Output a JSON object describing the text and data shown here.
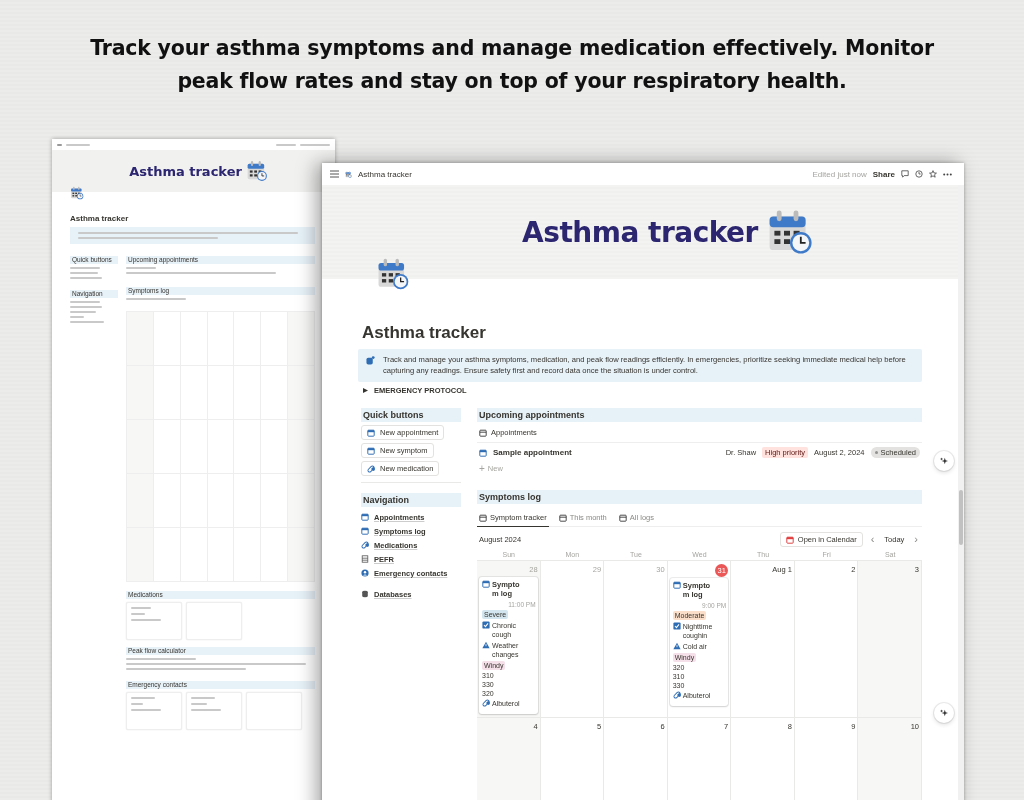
{
  "headline": [
    "Track your asthma symptoms and manage medication effectively. Monitor",
    "peak flow rates and stay on top of your respiratory health."
  ],
  "back_window": {
    "banner_title": "Asthma tracker",
    "title": "Asthma tracker",
    "side_sections": [
      "Quick buttons",
      "Navigation"
    ],
    "main_sections": [
      "Upcoming appointments",
      "Symptoms log",
      "Medications",
      "Peak flow calculator",
      "Emergency contacts"
    ]
  },
  "window": {
    "breadcrumb": "Asthma tracker",
    "edited": "Edited just now",
    "share": "Share"
  },
  "cover": {
    "title": "Asthma tracker"
  },
  "page": {
    "title": "Asthma tracker",
    "callout": "Track and manage your asthma symptoms, medication, and peak flow readings efficiently. In emergencies, prioritize seeking immediate medical help before capturing any readings. Ensure safety first and record data once the situation is under control.",
    "toggle": "EMERGENCY PROTOCOL"
  },
  "quick_buttons": {
    "heading": "Quick buttons",
    "buttons": [
      {
        "label": "New appointment",
        "kind": "calendar"
      },
      {
        "label": "New symptom",
        "kind": "calendar"
      },
      {
        "label": "New medication",
        "kind": "pill"
      }
    ]
  },
  "navigation": {
    "heading": "Navigation",
    "items": [
      {
        "label": "Appointments",
        "kind": "calendar"
      },
      {
        "label": "Symptoms log",
        "kind": "calendar"
      },
      {
        "label": "Medications",
        "kind": "pill"
      },
      {
        "label": "PEFR",
        "kind": "table"
      },
      {
        "label": "Emergency contacts",
        "kind": "contact"
      }
    ],
    "databases": {
      "label": "Databases",
      "kind": "database"
    }
  },
  "appointments": {
    "heading": "Upcoming appointments",
    "view": "Appointments",
    "rows": [
      {
        "name": "Sample appointment",
        "doctor": "Dr. Shaw",
        "priority": {
          "label": "High priority",
          "color": "#ffe2dd"
        },
        "date": "August 2, 2024",
        "status": "Scheduled"
      }
    ],
    "new_icon": "+",
    "new": "New"
  },
  "symptoms": {
    "heading": "Symptoms log",
    "tabs": [
      {
        "label": "Symptom tracker",
        "selected": true
      },
      {
        "label": "This month",
        "selected": false
      },
      {
        "label": "All logs",
        "selected": false
      }
    ],
    "month": "August 2024",
    "open_calendar": "Open in Calendar",
    "prev": "‹",
    "today": "Today",
    "next": "›",
    "weekdays": [
      "Sun",
      "Mon",
      "Tue",
      "Wed",
      "Thu",
      "Fri",
      "Sat"
    ],
    "weeks": [
      {
        "days": [
          {
            "label": "28",
            "outside": true,
            "today": false,
            "events": [
              {
                "title": "Sympto m log",
                "time": "11:00 PM",
                "severity": {
                  "label": "Severe",
                  "color": "#d3e5ef"
                },
                "symptom": "Chronic cough",
                "trigger": "Weather changes",
                "weather": {
                  "label": "Windy",
                  "color": "#f5e0e9"
                },
                "readings": [
                  "310",
                  "330",
                  "320"
                ],
                "medication": "Albuterol"
              }
            ]
          },
          {
            "label": "29",
            "outside": true,
            "today": false
          },
          {
            "label": "30",
            "outside": true,
            "today": false
          },
          {
            "label": "31",
            "outside": true,
            "today": true,
            "events": [
              {
                "title": "Sympto m log",
                "time": "9:00 PM",
                "severity": {
                  "label": "Moderate",
                  "color": "#fadec9"
                },
                "symptom": "Nighttime coughin",
                "trigger": "Cold air",
                "weather": {
                  "label": "Windy",
                  "color": "#f5e0e9"
                },
                "readings": [
                  "320",
                  "310",
                  "330"
                ],
                "medication": "Albuterol"
              }
            ]
          },
          {
            "label": "Aug 1",
            "outside": false,
            "today": false
          },
          {
            "label": "2",
            "outside": false,
            "today": false
          },
          {
            "label": "3",
            "outside": false,
            "today": false
          }
        ]
      },
      {
        "days": [
          {
            "label": "4",
            "outside": false,
            "today": false
          },
          {
            "label": "5",
            "outside": false,
            "today": false
          },
          {
            "label": "6",
            "outside": false,
            "today": false
          },
          {
            "label": "7",
            "outside": false,
            "today": false
          },
          {
            "label": "8",
            "outside": false,
            "today": false
          },
          {
            "label": "9",
            "outside": false,
            "today": false
          },
          {
            "label": "10",
            "outside": false,
            "today": false
          }
        ]
      }
    ]
  }
}
